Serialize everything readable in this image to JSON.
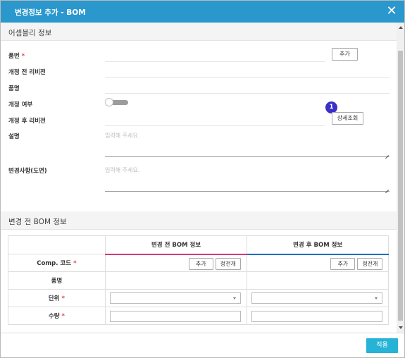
{
  "dialog": {
    "title": "변경정보 추가 - BOM"
  },
  "assembly": {
    "section_title": "어셈블리 정보",
    "labels": {
      "part_no": "품번",
      "rev_before": "개정 전 리비전",
      "part_name": "품명",
      "revise": "개정 여부",
      "rev_after": "개정 후 리비전",
      "description": "설명",
      "changes": "변경사항(도면)"
    },
    "required_mark": "*",
    "add_button": "추가",
    "detail_button": "상세조회",
    "badge": "1",
    "description_placeholder": "입력해 주세요.",
    "changes_placeholder": "입력해 주세요.",
    "toggle_on": false
  },
  "bom": {
    "section_title": "변경 전 BOM 정보",
    "col_before": "변경 전 BOM 정보",
    "col_after": "변경 후 BOM 정보",
    "rows": {
      "comp_code": "Comp. 코드",
      "part_name": "품명",
      "unit": "단위",
      "qty": "수량"
    },
    "add_button": "추가",
    "sort_button": "정전개"
  },
  "footer": {
    "apply_button": "적용"
  }
}
